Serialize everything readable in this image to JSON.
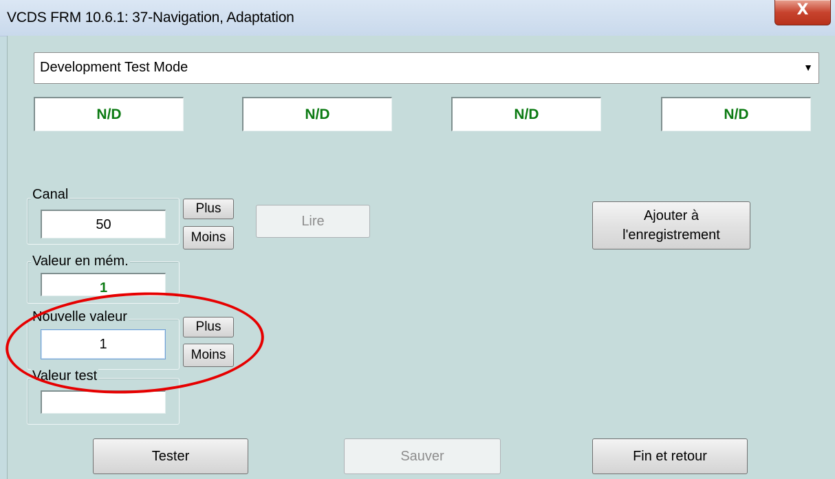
{
  "window": {
    "title": "VCDS FRM 10.6.1: 37-Navigation,  Adaptation",
    "close_glyph": "X"
  },
  "mode_select": {
    "value": "Development Test Mode",
    "arrow": "▼"
  },
  "status_fields": [
    "N/D",
    "N/D",
    "N/D",
    "N/D"
  ],
  "canal": {
    "label": "Canal",
    "value": "50",
    "plus": "Plus",
    "minus": "Moins"
  },
  "read_button": "Lire",
  "add_log_button": {
    "line1": "Ajouter à",
    "line2": "l'enregistrement"
  },
  "stored_value": {
    "label": "Valeur en mém.",
    "value": "1"
  },
  "new_value": {
    "label": "Nouvelle valeur",
    "value": "1",
    "plus": "Plus",
    "minus": "Moins"
  },
  "test_value": {
    "label": "Valeur test",
    "value": ""
  },
  "footer": {
    "test": "Tester",
    "save": "Sauver",
    "exit": "Fin et retour"
  },
  "colors": {
    "status_text": "#0b7a12",
    "highlight": "#e60000",
    "background": "#c6dcdb"
  }
}
